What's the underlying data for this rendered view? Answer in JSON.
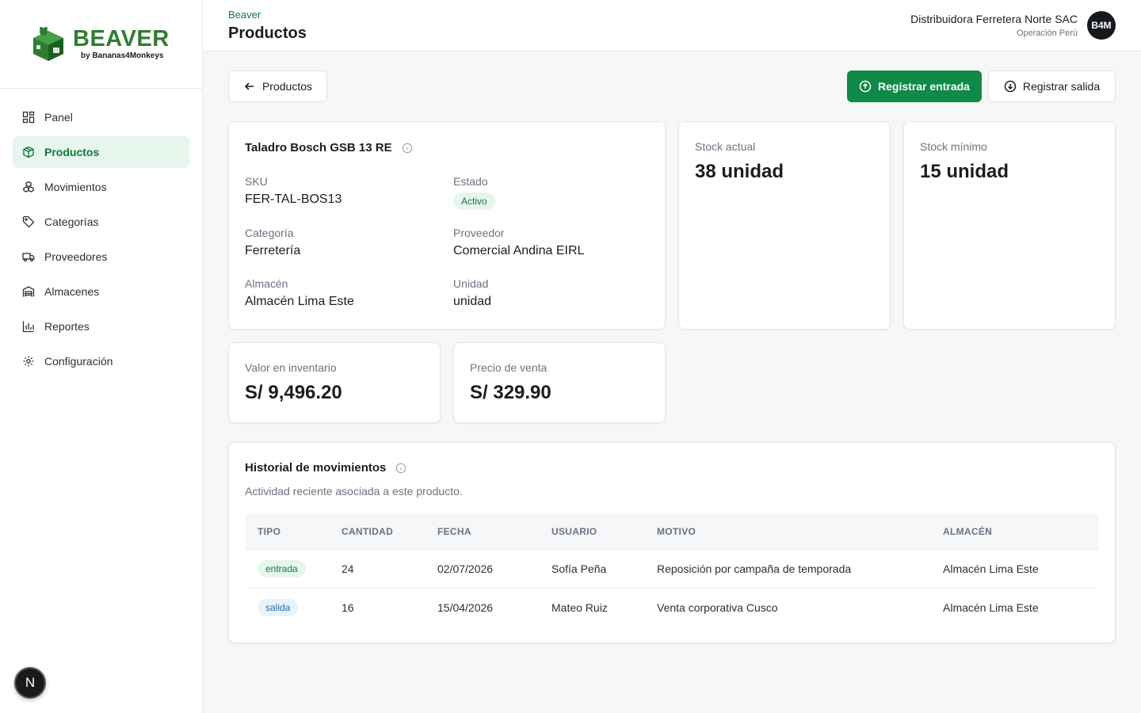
{
  "brand": {
    "name": "BEAVER",
    "sub": "by Bananas4Monkeys",
    "primary_color": "#2e7d32"
  },
  "sidebar": {
    "items": [
      {
        "label": "Panel",
        "icon": "grid-icon"
      },
      {
        "label": "Productos",
        "icon": "box-icon",
        "active": true
      },
      {
        "label": "Movimientos",
        "icon": "boxes-icon"
      },
      {
        "label": "Categorías",
        "icon": "tag-icon"
      },
      {
        "label": "Proveedores",
        "icon": "truck-icon"
      },
      {
        "label": "Almacenes",
        "icon": "warehouse-icon"
      },
      {
        "label": "Reportes",
        "icon": "bar-chart-icon"
      },
      {
        "label": "Configuración",
        "icon": "gear-icon"
      }
    ],
    "badge": "N"
  },
  "header": {
    "breadcrumb": "Beaver",
    "title": "Productos",
    "org_name": "Distribuidora Ferretera Norte SAC",
    "org_sub": "Operación Perú",
    "avatar": "B4M"
  },
  "actions": {
    "back_label": "Productos",
    "entrada_label": "Registrar entrada",
    "salida_label": "Registrar salida"
  },
  "product": {
    "name": "Taladro Bosch GSB 13 RE",
    "sku_label": "SKU",
    "sku": "FER-TAL-BOS13",
    "estado_label": "Estado",
    "estado": "Activo",
    "categoria_label": "Categoría",
    "categoria": "Ferretería",
    "proveedor_label": "Proveedor",
    "proveedor": "Comercial Andina EIRL",
    "almacen_label": "Almacén",
    "almacen": "Almacén Lima Este",
    "unidad_label": "Unidad",
    "unidad": "unidad"
  },
  "stats": {
    "stock_actual_label": "Stock actual",
    "stock_actual": "38 unidad",
    "stock_minimo_label": "Stock mínimo",
    "stock_minimo": "15 unidad",
    "valor_label": "Valor en inventario",
    "valor": "S/ 9,496.20",
    "precio_label": "Precio de venta",
    "precio": "S/ 329.90"
  },
  "history": {
    "title": "Historial de movimientos",
    "subtitle": "Actividad reciente asociada a este producto.",
    "columns": [
      "TIPO",
      "CANTIDAD",
      "FECHA",
      "USUARIO",
      "MOTIVO",
      "ALMACÉN"
    ],
    "rows": [
      {
        "tipo": "entrada",
        "cantidad": "24",
        "fecha": "02/07/2026",
        "usuario": "Sofía Peña",
        "motivo": "Reposición por campaña de temporada",
        "almacen": "Almacén Lima Este"
      },
      {
        "tipo": "salida",
        "cantidad": "16",
        "fecha": "15/04/2026",
        "usuario": "Mateo Ruiz",
        "motivo": "Venta corporativa Cusco",
        "almacen": "Almacén Lima Este"
      }
    ]
  }
}
